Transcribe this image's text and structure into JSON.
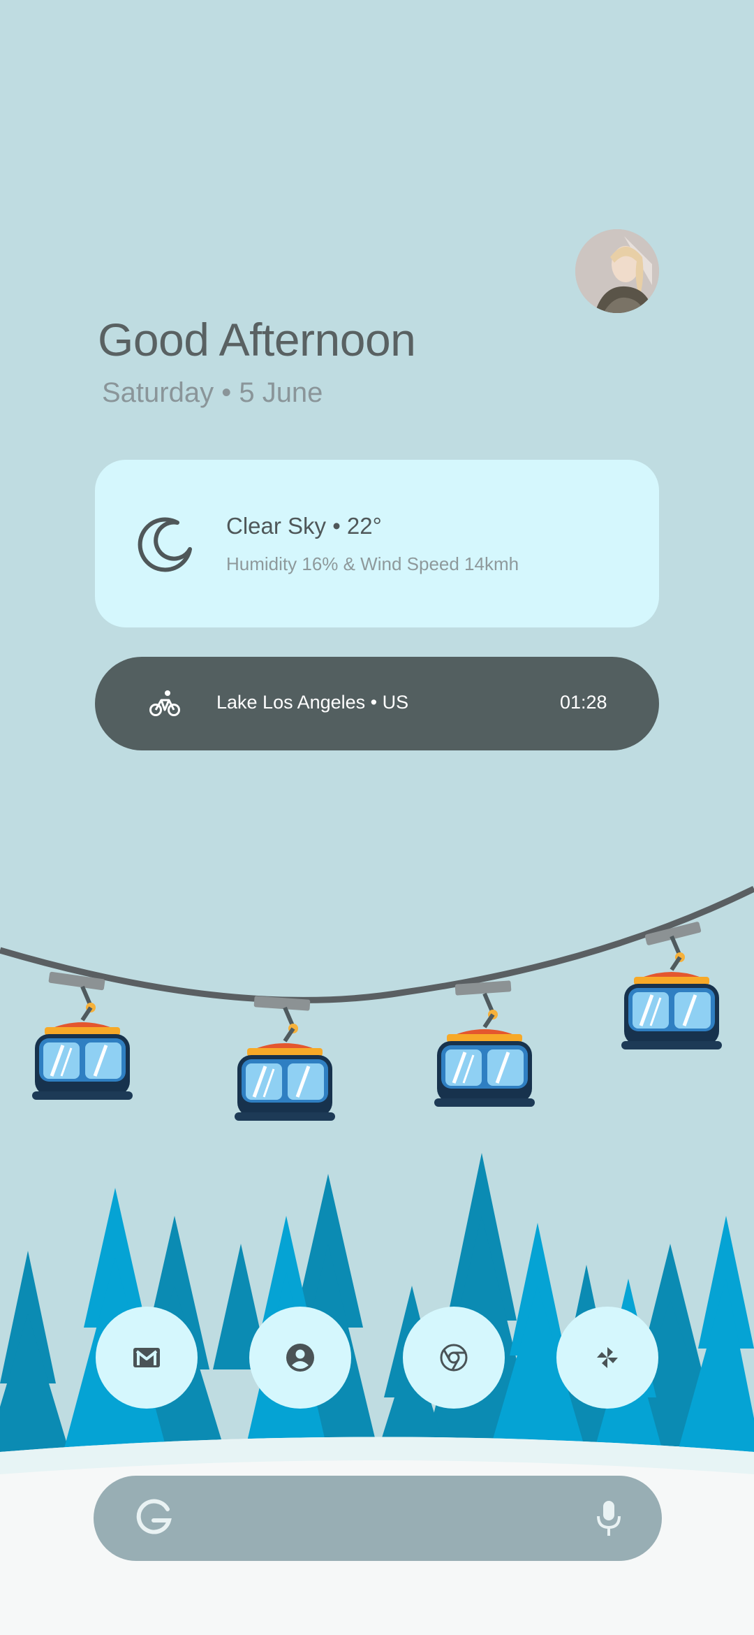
{
  "greeting": {
    "title": "Good Afternoon",
    "date": "Saturday • 5 June"
  },
  "weather": {
    "icon": "moon-icon",
    "title": "Clear Sky • 22°",
    "details": "Humidity 16% & Wind Speed 14kmh"
  },
  "activity": {
    "icon": "bicycle-icon",
    "location": "Lake Los Angeles • US",
    "time": "01:28"
  },
  "dock": [
    {
      "app": "Gmail",
      "icon": "gmail-icon"
    },
    {
      "app": "Contacts",
      "icon": "account-icon"
    },
    {
      "app": "Chrome",
      "icon": "chrome-icon"
    },
    {
      "app": "Pinwheel",
      "icon": "pinwheel-icon"
    }
  ],
  "search": {
    "logo": "google-g-icon",
    "mic": "microphone-icon"
  },
  "colors": {
    "background": "#bfdce1",
    "card": "#d5f7fd",
    "pill": "#535f60",
    "search": "#98aeb4",
    "snow": "#f6f8f8"
  }
}
